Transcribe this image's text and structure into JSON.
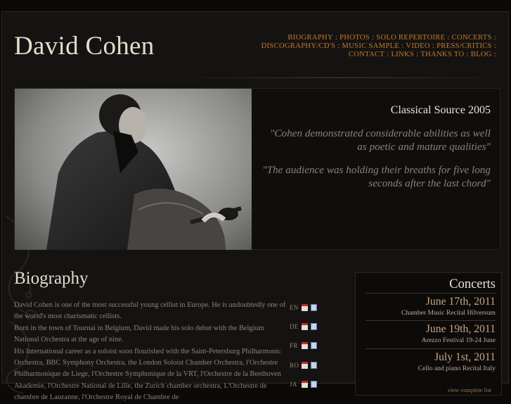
{
  "site": {
    "title": "David Cohen"
  },
  "nav": {
    "rows": [
      [
        "BIOGRAPHY",
        "PHOTOS",
        "SOLO REPERTOIRE",
        "CONCERTS"
      ],
      [
        "DISCOGRAPHY/CD'S",
        "MUSIC SAMPLE",
        "VIDEO",
        "PRESS/CRITICS"
      ],
      [
        "CONTACT",
        "LINKS",
        "THANKS TO",
        "BLOG"
      ]
    ],
    "separator": ":"
  },
  "hero": {
    "photo_icon": "cellist-portrait-photo",
    "review_source": "Classical Source 2005",
    "quotes": [
      "\"Cohen demonstrated considerable abilities as well as poetic and mature qualities\"",
      "\"The audience was holding their breaths for five long seconds after the last chord\""
    ]
  },
  "biography": {
    "heading": "Biography",
    "paragraphs": [
      "David Cohen is one of the most successful young cellist in Europe. He is undoubtedly one of the world's most charismatic cellists.",
      "Born in the town of Tournai in Belgium, David made his solo debut with the Belgium National Orchestra at the age of nine.",
      "His International career as a soloist soon flourished with the Saint-Petersburg Philharmonic Orchestra, BBC Symphony Orchestra, the London Soloist Chamber Orchestra, l'Orchestre Philharmonique de Liege, l'Orchestre Symphonique de la VRT, l'Orchestre de la Beethoven Akademie, l'Orchestre National de Lille, the Zurich chamber orchestra, L'Orchestre de chambre de Lauzanne, l'Orchestre Royal de Chambre de"
    ],
    "languages": [
      {
        "code": "EN",
        "icons": [
          "pdf-icon",
          "document-icon"
        ]
      },
      {
        "code": "DE",
        "icons": [
          "pdf-icon",
          "document-icon"
        ]
      },
      {
        "code": "FR",
        "icons": [
          "pdf-icon",
          "document-icon"
        ]
      },
      {
        "code": "RO",
        "icons": [
          "pdf-icon",
          "document-icon"
        ]
      },
      {
        "code": "JA",
        "icons": [
          "pdf-icon",
          "document-icon"
        ]
      }
    ]
  },
  "concerts": {
    "title": "Concerts",
    "items": [
      {
        "date": "June 17th, 2011",
        "venue": "Chamber Music Recital Hilversum"
      },
      {
        "date": "June 19th, 2011",
        "venue": "Arezzo Festival 19-24 June"
      },
      {
        "date": "July 1st, 2011",
        "venue": "Cello and piano Recital Italy"
      }
    ],
    "view_all": "view complete list"
  }
}
